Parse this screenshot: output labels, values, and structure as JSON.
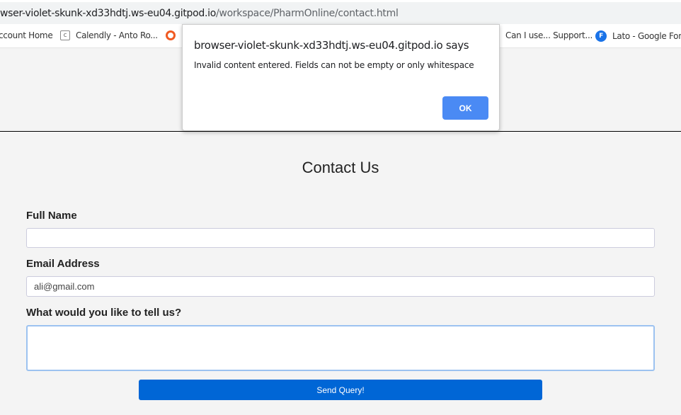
{
  "browser": {
    "url_host": "wser-violet-skunk-xd33hdtj.ws-eu04.gitpod.io",
    "url_path": "/workspace/PharmOnline/contact.html",
    "bookmarks": [
      {
        "label": "ccount Home",
        "icon": "none"
      },
      {
        "label": "Calendly - Anto Ro...",
        "icon": "calendly-icon"
      },
      {
        "label": "",
        "icon": "orange-ring-icon"
      },
      {
        "label": "Can I use... Support...",
        "icon": "none"
      },
      {
        "label": "Lato - Google Font",
        "icon": "google-fonts-icon"
      }
    ]
  },
  "dialog": {
    "title": "browser-violet-skunk-xd33hdtj.ws-eu04.gitpod.io says",
    "message": "Invalid content entered. Fields can not be empty or only whitespace",
    "ok_label": "OK"
  },
  "page": {
    "heading": "Contact Us",
    "full_name_label": "Full Name",
    "full_name_value": "",
    "email_label": "Email Address",
    "email_value": "ali@gmail.com",
    "message_label": "What would you like to tell us?",
    "message_value": "",
    "submit_label": "Send Query!"
  },
  "colors": {
    "accent": "#0066d6",
    "dialog_button": "#4a8af4"
  }
}
